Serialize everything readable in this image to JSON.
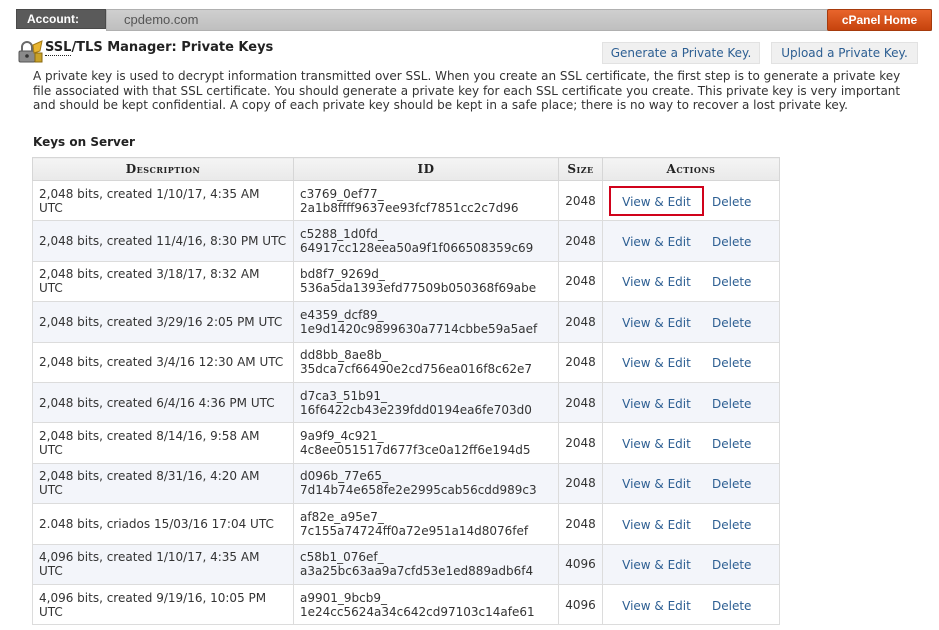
{
  "topbar": {
    "account_label": "Account:",
    "account_value": "cpdemo.com",
    "home_button": "cPanel Home"
  },
  "header": {
    "title_prefix": "SSL",
    "title_rest": "/TLS Manager: Private Keys",
    "generate_button": "Generate a Private Key.",
    "upload_button": "Upload a Private Key."
  },
  "intro": {
    "text": "A private key is used to decrypt information transmitted over SSL. When you create an SSL certificate, the first step is to generate a private key file associated with that SSL certificate. You should generate a private key for each SSL certificate you create. This private key is very important and should be kept confidential. A copy of each private key should be kept in a safe place; there is no way to recover a lost private key."
  },
  "section_title": "Keys on Server",
  "table": {
    "headers": {
      "description": "Description",
      "id": "ID",
      "size": "Size",
      "actions": "Actions"
    },
    "view_label": "View & Edit",
    "delete_label": "Delete",
    "rows": [
      {
        "description": "2,048 bits, created 1/10/17, 4:35 AM UTC",
        "id1": "c3769_0ef77_",
        "id2": "2a1b8ffff9637ee93fcf7851cc2c7d96",
        "size": "2048"
      },
      {
        "description": "2,048 bits, created 11/4/16, 8:30 PM UTC",
        "id1": "c5288_1d0fd_",
        "id2": "64917cc128eea50a9f1f066508359c69",
        "size": "2048"
      },
      {
        "description": "2,048 bits, created 3/18/17, 8:32 AM UTC",
        "id1": "bd8f7_9269d_",
        "id2": "536a5da1393efd77509b050368f69abe",
        "size": "2048"
      },
      {
        "description": "2,048 bits, created 3/29/16 2:05 PM UTC",
        "id1": "e4359_dcf89_",
        "id2": "1e9d1420c9899630a7714cbbe59a5aef",
        "size": "2048"
      },
      {
        "description": "2,048 bits, created 3/4/16 12:30 AM UTC",
        "id1": "dd8bb_8ae8b_",
        "id2": "35dca7cf66490e2cd756ea016f8c62e7",
        "size": "2048"
      },
      {
        "description": "2,048 bits, created 6/4/16 4:36 PM UTC",
        "id1": "d7ca3_51b91_",
        "id2": "16f6422cb43e239fdd0194ea6fe703d0",
        "size": "2048"
      },
      {
        "description": "2,048 bits, created 8/14/16, 9:58 AM UTC",
        "id1": "9a9f9_4c921_",
        "id2": "4c8ee051517d677f3ce0a12ff6e194d5",
        "size": "2048"
      },
      {
        "description": "2,048 bits, created 8/31/16, 4:20 AM UTC",
        "id1": "d096b_77e65_",
        "id2": "7d14b74e658fe2e2995cab56cdd989c3",
        "size": "2048"
      },
      {
        "description": "2.048 bits, criados 15/03/16 17:04 UTC",
        "id1": "af82e_a95e7_",
        "id2": "7c155a74724ff0a72e951a14d8076fef",
        "size": "2048"
      },
      {
        "description": "4,096 bits, created 1/10/17, 4:35 AM UTC",
        "id1": "c58b1_076ef_",
        "id2": "a3a25bc63aa9a7cfd53e1ed889adb6f4",
        "size": "4096"
      },
      {
        "description": "4,096 bits, created 9/19/16, 10:05 PM UTC",
        "id1": "a9901_9bcb9_",
        "id2": "1e24cc5624a34c642cd97103c14afe61",
        "size": "4096"
      }
    ]
  },
  "colors": {
    "link": "#2c5e92",
    "home_button": "#d9531e",
    "highlight_border": "#d0021b"
  },
  "icons": {
    "app_icon": "ssl-lock-icon"
  }
}
